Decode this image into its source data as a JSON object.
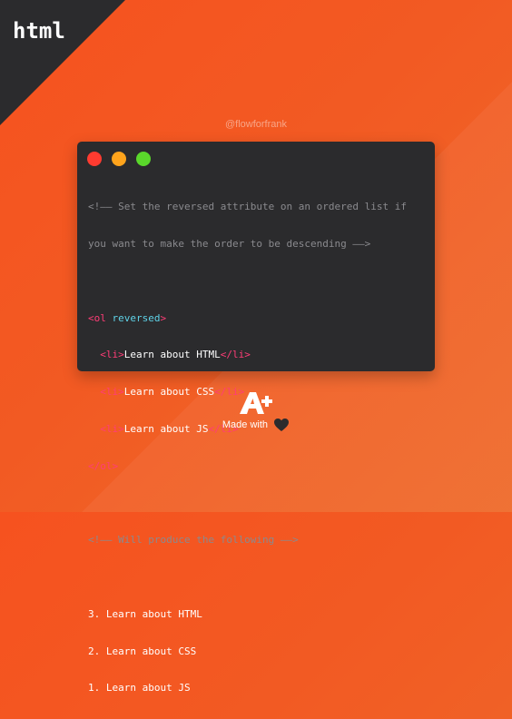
{
  "corner": {
    "label": "html"
  },
  "handle": "@flowforfrank",
  "editor": {
    "comment1_line1": "<!—— Set the reversed attribute on an ordered list if",
    "comment1_line2": "you want to make the order to be descending ——>",
    "ol_open_tag": "<ol",
    "ol_attr": "reversed",
    "ol_open_close": ">",
    "li_open": "<li>",
    "li_close": "</li>",
    "items": [
      "Learn about HTML",
      "Learn about CSS",
      "Learn about JS"
    ],
    "ol_close": "</ol>",
    "comment2": "<!—— Will produce the following ——>",
    "output": [
      "3. Learn about HTML",
      "2. Learn about CSS",
      "1. Learn about JS"
    ]
  },
  "footer": {
    "made_with": "Made with"
  },
  "colors": {
    "background": "#f6521f",
    "window": "#2b2b2d",
    "tag": "#ff3d77",
    "attribute": "#5fd3e8",
    "comment": "#8a8a8e"
  },
  "icons": [
    "a-plus-logo-icon",
    "heart-icon"
  ]
}
